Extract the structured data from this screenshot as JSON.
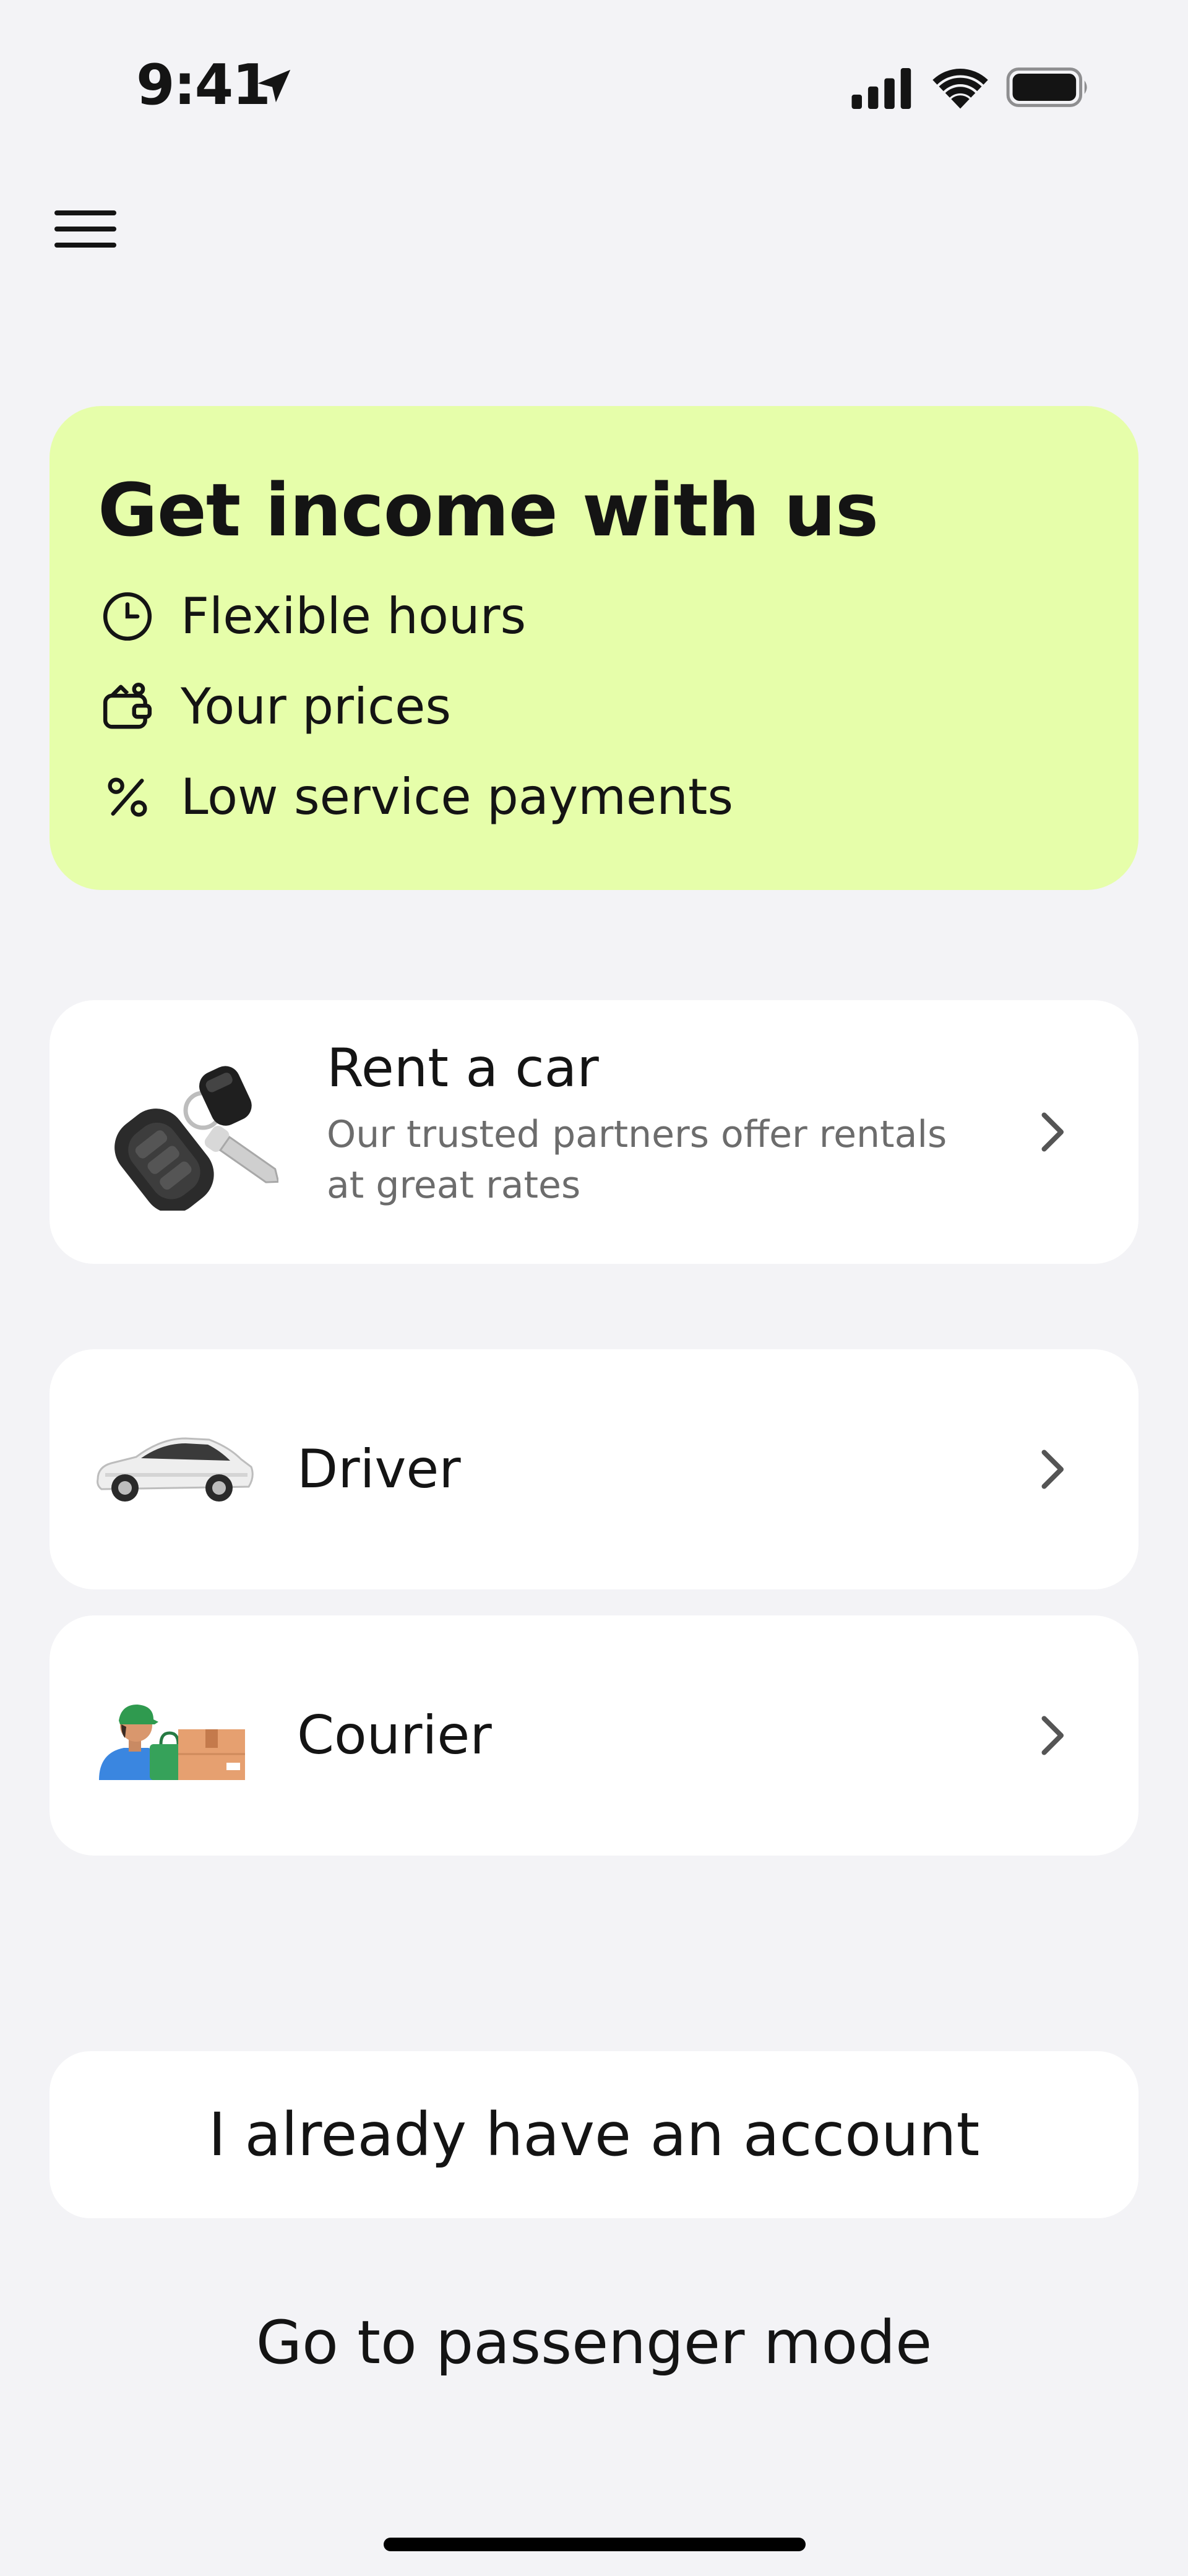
{
  "status_bar": {
    "time": "9:41"
  },
  "promo": {
    "title": "Get income with us",
    "features": [
      {
        "icon": "clock-icon",
        "label": "Flexible hours"
      },
      {
        "icon": "wallet-icon",
        "label": "Your prices"
      },
      {
        "icon": "percent-icon",
        "label": "Low service payments"
      }
    ]
  },
  "options": {
    "rent": {
      "title": "Rent a car",
      "subtitle_line1": "Our trusted partners offer rentals",
      "subtitle_line2": "at great rates",
      "icon": "car-keys-icon"
    },
    "driver": {
      "title": "Driver",
      "icon": "car-icon"
    },
    "courier": {
      "title": "Courier",
      "icon": "courier-icon"
    }
  },
  "actions": {
    "account_label": "I already have an account",
    "passenger_label": "Go to passenger mode"
  },
  "colors": {
    "background": "#f3f3f6",
    "promo_background": "#e6feaa",
    "card_background": "#ffffff",
    "text": "#141414",
    "subtext": "#6c6c6c"
  }
}
